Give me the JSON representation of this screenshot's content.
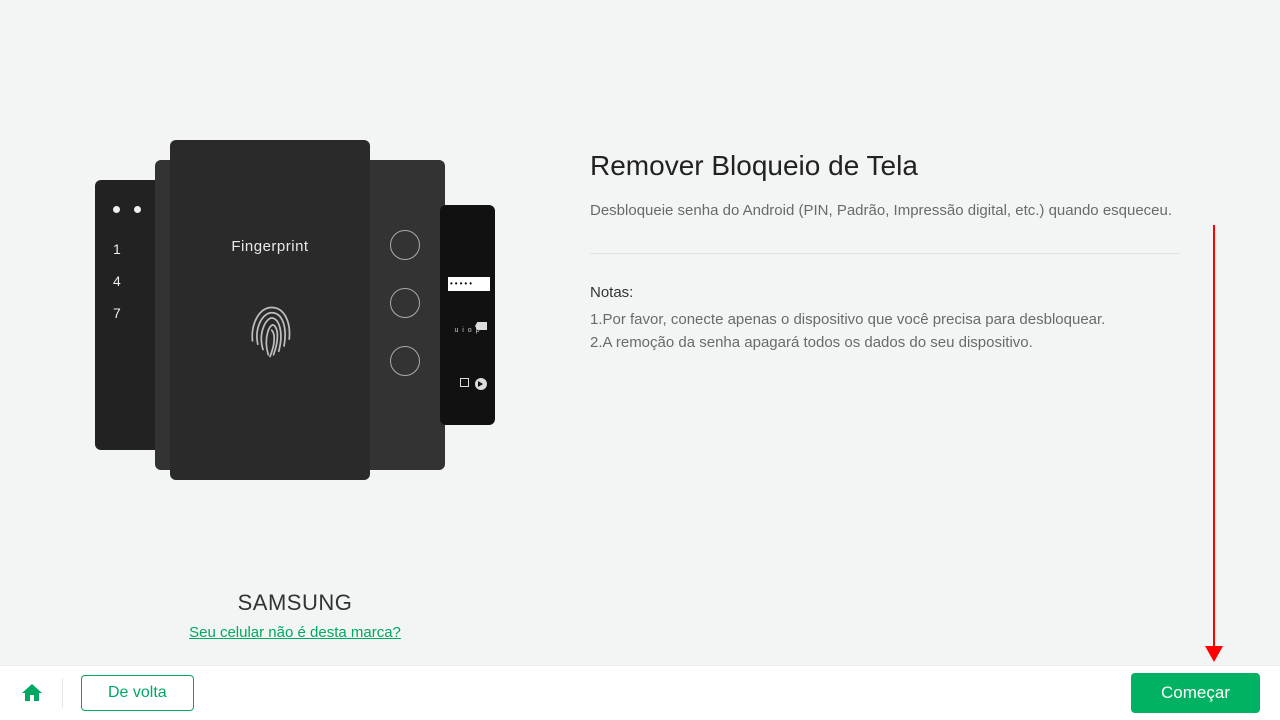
{
  "left": {
    "fingerprint_label": "Fingerprint",
    "pin_numbers": [
      "1",
      "4",
      "7"
    ],
    "password_dots": "•••••",
    "keyboard_row": "u i o p",
    "brand": "SAMSUNG",
    "brand_link": "Seu celular não é desta marca?"
  },
  "right": {
    "title": "Remover Bloqueio de Tela",
    "description": "Desbloqueie senha do Android (PIN, Padrão, Impressão digital, etc.) quando esqueceu.",
    "notes_heading": "Notas:",
    "note1": "1.Por favor, conecte apenas o dispositivo que você precisa para desbloquear.",
    "note2": "2.A remoção da senha apagará todos os dados do seu dispositivo."
  },
  "footer": {
    "back": "De volta",
    "start": "Começar"
  }
}
